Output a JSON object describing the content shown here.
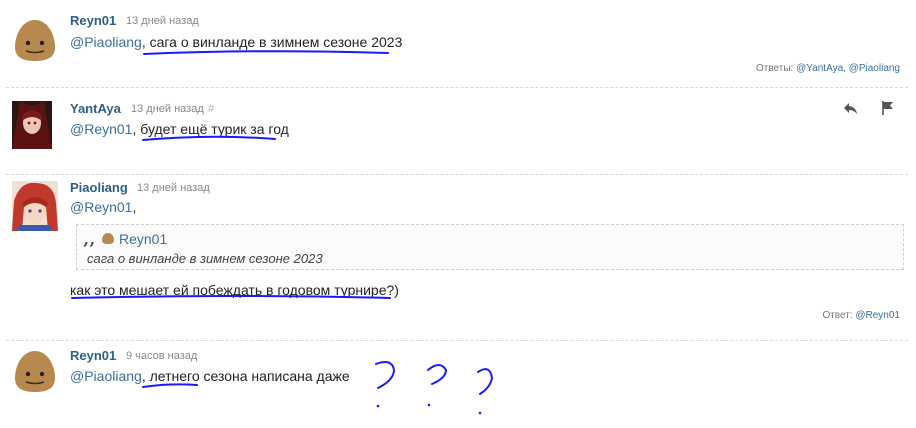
{
  "comments": [
    {
      "author": "Reyn01",
      "time": "13 дней назад",
      "mention": "@Piaoliang",
      "text": "сага о винланде в зимнем сезоне 2023",
      "replies_label": "Ответы:",
      "replies": [
        "@YantAya",
        "@Piaoliang"
      ]
    },
    {
      "author": "YantAya",
      "time": "13 дней назад",
      "hash": "#",
      "mention": "@Reyn01",
      "text": "будет ещё турик за год"
    },
    {
      "author": "Piaoliang",
      "time": "13 дней назад",
      "mention": "@Reyn01",
      "quote_author": "Reyn01",
      "quote_text": "сага о винланде в зимнем сезоне 2023",
      "text": "как это мешает ей побеждать в годовом турнире?)",
      "replies_label": "Ответ:",
      "replies": [
        "@Reyn01"
      ]
    },
    {
      "author": "Reyn01",
      "time": "9 часов назад",
      "mention": "@Piaoliang",
      "text": "летнего сезона написана даже"
    }
  ],
  "icons": [
    "reply-icon",
    "flag-icon",
    "quote-mark-icon"
  ],
  "colors": {
    "author": "#2e5f8a",
    "mention": "#3a6ea5",
    "annotation": "#1a1aff"
  }
}
